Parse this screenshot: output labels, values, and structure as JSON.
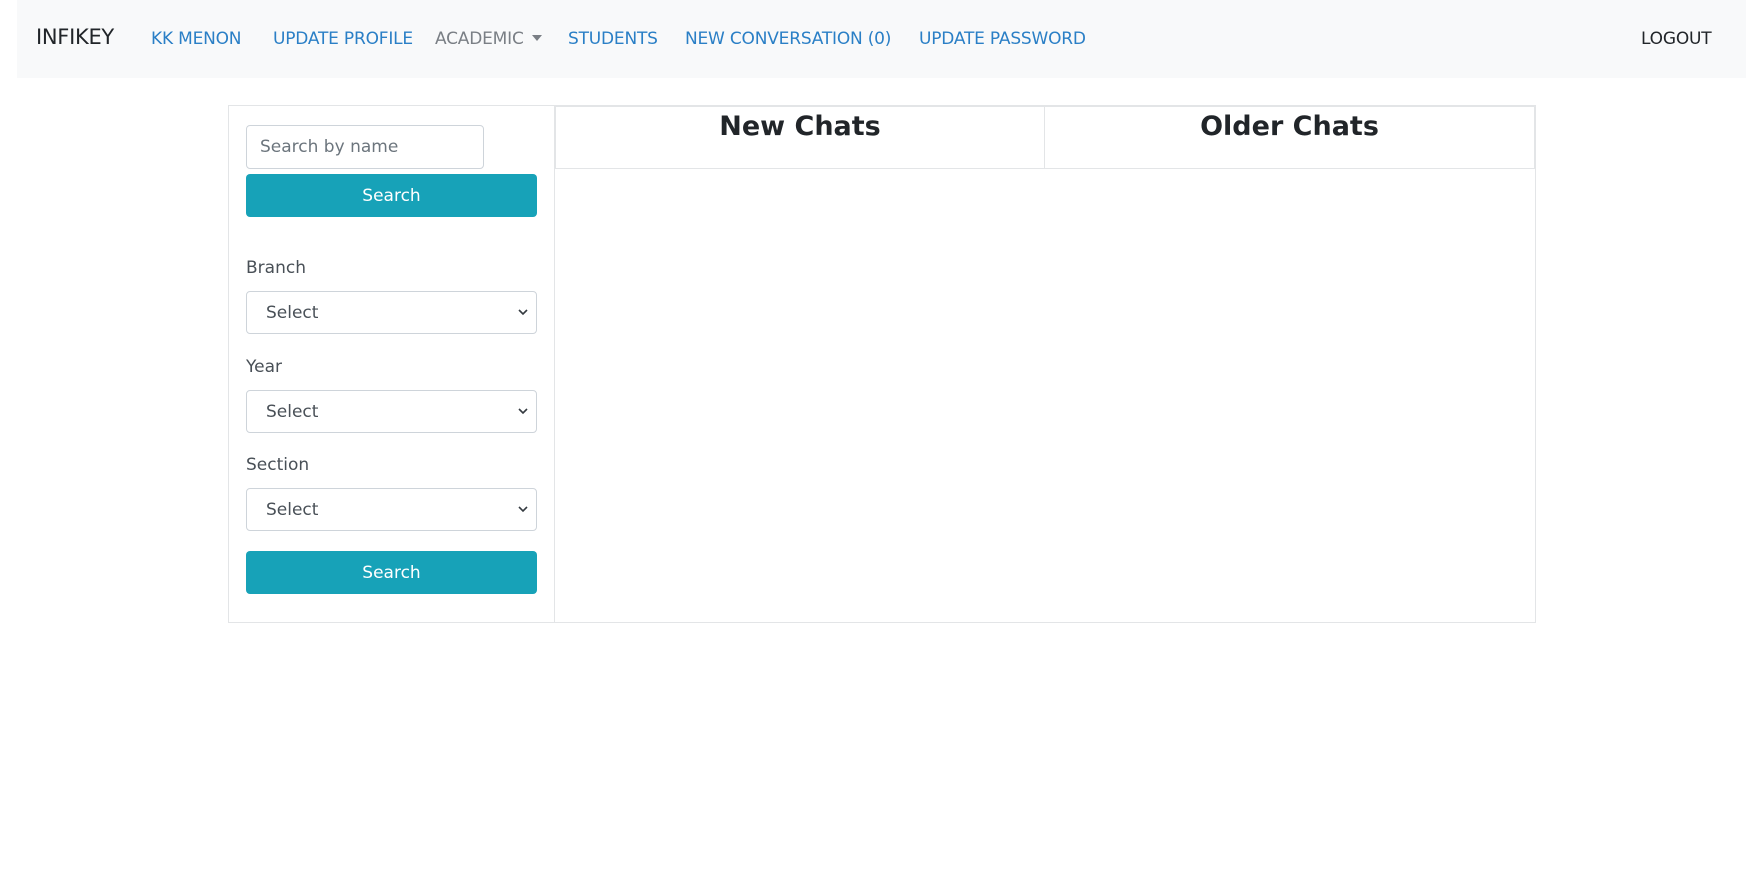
{
  "navbar": {
    "brand": "INFIKEY",
    "links": {
      "user": "KK MENON",
      "update_profile": "UPDATE PROFILE",
      "academic": "ACADEMIC",
      "students": "STUDENTS",
      "new_conversation": "NEW CONVERSATION (0)",
      "update_password": "UPDATE PASSWORD",
      "logout": "LOGOUT"
    }
  },
  "filters": {
    "search_placeholder": "Search by name",
    "search_button": "Search",
    "branch": {
      "label": "Branch",
      "value": "Select"
    },
    "year": {
      "label": "Year",
      "value": "Select"
    },
    "section": {
      "label": "Section",
      "value": "Select"
    },
    "filter_search_button": "Search"
  },
  "chats": {
    "new_title": "New Chats",
    "older_title": "Older Chats"
  },
  "colors": {
    "link": "#2a7fc6",
    "button": "#17a2b8",
    "navbar_bg": "#f8f9fa"
  }
}
